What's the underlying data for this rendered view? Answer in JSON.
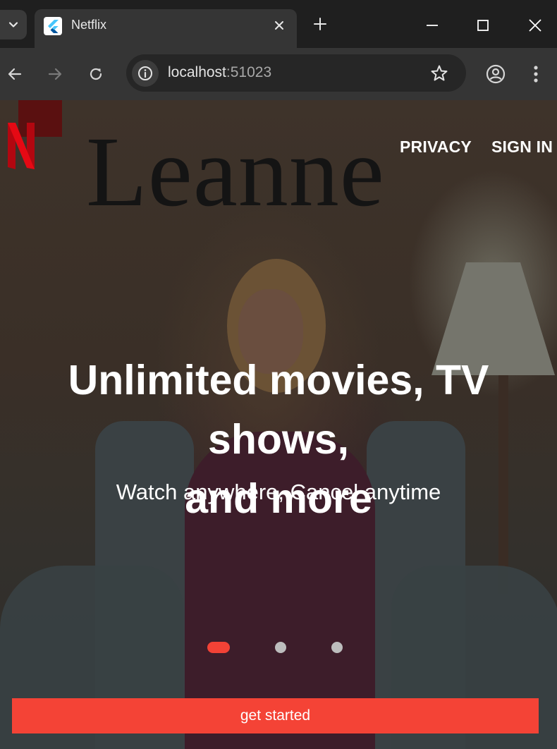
{
  "browser": {
    "tab": {
      "title": "Netflix"
    },
    "address_bar": {
      "host": "localhost",
      "port": ":51023"
    }
  },
  "page": {
    "poster_title": "Leanne",
    "nav": {
      "privacy": "PRIVACY",
      "sign_in": "SIGN IN"
    },
    "hero": {
      "headline_line1": "Unlimited movies, TV shows,",
      "headline_line2": "and more",
      "subheadline": "Watch anywhere, Cancel anytime"
    },
    "carousel": {
      "total_pages": 3,
      "active_page": 1
    },
    "cta_label": "get started"
  },
  "colors": {
    "brand_red": "#e50914",
    "button_red": "#f44336",
    "chrome_dark": "#1f1f1f",
    "chrome_toolbar": "#353535"
  },
  "icons": {
    "tab_search": "chevron-down-icon",
    "favicon": "flutter-icon",
    "tab_close": "close-icon",
    "new_tab": "plus-icon",
    "minimize": "minimize-icon",
    "maximize": "maximize-icon",
    "close_window": "close-icon",
    "back": "arrow-left-icon",
    "forward": "arrow-right-icon",
    "reload": "reload-icon",
    "site_info": "info-icon",
    "bookmark": "star-icon",
    "profile": "profile-icon",
    "menu": "more-vert-icon",
    "logo": "netflix-logo"
  }
}
